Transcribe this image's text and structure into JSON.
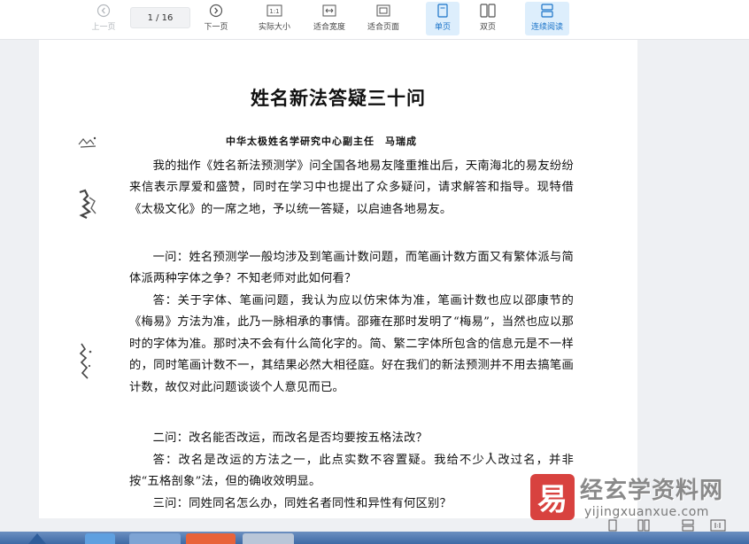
{
  "toolbar": {
    "prev_page": "上一页",
    "page_indicator": "1 / 16",
    "next_page": "下一页",
    "actual_size": "实际大小",
    "fit_width": "适合宽度",
    "fit_page": "适合页面",
    "single_page": "单页",
    "double_page": "双页",
    "continuous": "连续阅读",
    "actual_size_icon_text": "1:1"
  },
  "document": {
    "title": "姓名新法答疑三十问",
    "author_line": "中华太极姓名学研究中心副主任　马瑞成",
    "paragraphs": [
      "我的拙作《姓名新法预测学》问全国各地易友隆重推出后，天南海北的易友纷纷来信表示厚爱和盛赞，同时在学习中也提出了众多疑问，请求解答和指导。现特借《太极文化》的一席之地，予以统一答疑，以启迪各地易友。",
      "一问：姓名预测学一般均涉及到笔画计数问题，而笔画计数方面又有繁体派与简体派两种字体之争？不知老师对此如何看？",
      "答：关于字体、笔画问题，我认为应以仿宋体为准，笔画计数也应以邵康节的《梅易》方法为准，此乃一脉相承的事情。邵雍在那时发明了“梅易”，当然也应以那时的字体为准。那时决不会有什么简化字的。简、繁二字体所包含的信息元是不一样的，同时笔画计数不一，其结果必然大相径庭。好在我们的新法预测并不用去搞笔画计数，故仅对此问题谈谈个人意见而已。",
      "二问：改名能否改运，而改名是否均要按五格法改？",
      "答：改名是改运的方法之一，此点实数不容置疑。我给不少人改过名，并非按“五格剖象”法，但的确收效明显。",
      "三问：同姓同名怎么办，同姓名者同性和异性有何区别？"
    ]
  },
  "watermark": {
    "title": "经玄学资料网",
    "url": "yijingxuanxue.com",
    "logo_glyph": "易"
  },
  "colors": {
    "active_bg": "#ddeefc",
    "active_text": "#1a73c8",
    "watermark_red": "#d8423f",
    "taskbar": "#4a75b0"
  }
}
